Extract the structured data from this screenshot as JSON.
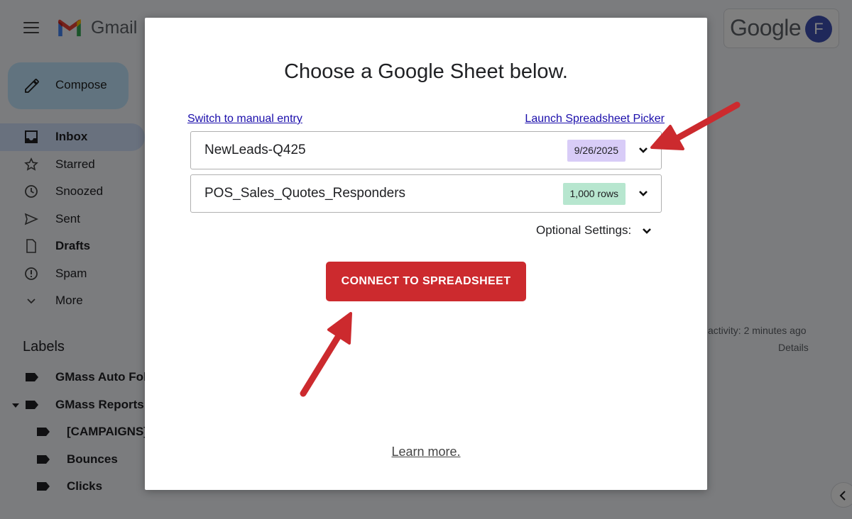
{
  "gmail": {
    "app_name": "Gmail",
    "google_word": "Google",
    "avatar_initial": "F",
    "compose_label": "Compose",
    "nav": [
      {
        "label": "Inbox",
        "bold": true
      },
      {
        "label": "Starred"
      },
      {
        "label": "Snoozed"
      },
      {
        "label": "Sent"
      },
      {
        "label": "Drafts",
        "bold": true
      },
      {
        "label": "Spam"
      },
      {
        "label": "More"
      }
    ],
    "labels_heading": "Labels",
    "labels": [
      {
        "label": "GMass Auto Fol"
      },
      {
        "label": "GMass Reports"
      },
      {
        "label": "[CAMPAIGNS]"
      },
      {
        "label": "Bounces"
      },
      {
        "label": "Clicks"
      }
    ],
    "activity_text": "activity: 2 minutes ago",
    "details_text": "Details"
  },
  "modal": {
    "title": "Choose a Google Sheet below.",
    "manual_link": "Switch to manual entry",
    "picker_link": "Launch Spreadsheet Picker",
    "sheets": [
      {
        "name": "NewLeads-Q425",
        "badge": "9/26/2025"
      },
      {
        "name": "POS_Sales_Quotes_Responders",
        "badge": "1,000 rows"
      }
    ],
    "optional_settings": "Optional Settings:",
    "connect_button": "CONNECT TO SPREADSHEET",
    "learn_more": "Learn more."
  },
  "colors": {
    "connect_button": "#cc2a2e",
    "date_badge": "#d8ccf7",
    "rows_badge": "#b7e6cf",
    "link": "#1a0dab",
    "annotation_arrow": "#cc2a2e"
  }
}
